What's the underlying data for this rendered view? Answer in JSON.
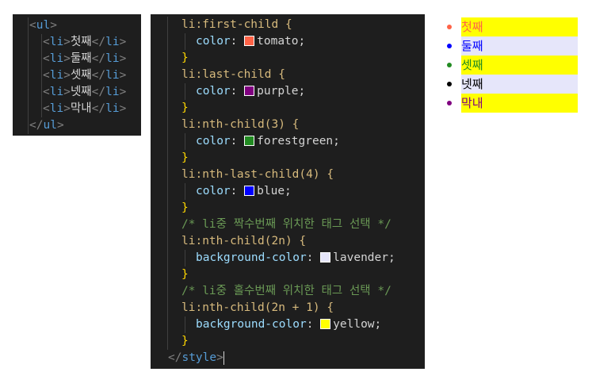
{
  "html_editor": {
    "lines": [
      {
        "indent": 0,
        "open_tag": "ul",
        "text": "",
        "close_tag": ""
      },
      {
        "indent": 1,
        "open_tag": "li",
        "text": "첫째",
        "close_tag": "li"
      },
      {
        "indent": 1,
        "open_tag": "li",
        "text": "둘째",
        "close_tag": "li"
      },
      {
        "indent": 1,
        "open_tag": "li",
        "text": "셋째",
        "close_tag": "li"
      },
      {
        "indent": 1,
        "open_tag": "li",
        "text": "넷째",
        "close_tag": "li"
      },
      {
        "indent": 1,
        "open_tag": "li",
        "text": "막내",
        "close_tag": "li"
      },
      {
        "indent": 0,
        "open_tag": "",
        "text": "",
        "close_tag": "ul"
      }
    ]
  },
  "css_editor": {
    "lines": [
      {
        "kind": "selector",
        "text": "li:first-child {"
      },
      {
        "kind": "decl",
        "prop": "color",
        "swatch": "#ff6347",
        "value": "tomato"
      },
      {
        "kind": "close",
        "text": "}"
      },
      {
        "kind": "selector",
        "text": "li:last-child {"
      },
      {
        "kind": "decl",
        "prop": "color",
        "swatch": "#800080",
        "value": "purple"
      },
      {
        "kind": "close",
        "text": "}"
      },
      {
        "kind": "selector",
        "text": "li:nth-child(3) {"
      },
      {
        "kind": "decl",
        "prop": "color",
        "swatch": "#228b22",
        "value": "forestgreen"
      },
      {
        "kind": "close",
        "text": "}"
      },
      {
        "kind": "selector",
        "text": "li:nth-last-child(4) {"
      },
      {
        "kind": "decl",
        "prop": "color",
        "swatch": "#0000ff",
        "value": "blue"
      },
      {
        "kind": "close",
        "text": "}"
      },
      {
        "kind": "comment",
        "text": "/* li중 짝수번째 위치한 태그 선택 */"
      },
      {
        "kind": "selector",
        "text": "li:nth-child(2n) {"
      },
      {
        "kind": "decl",
        "prop": "background-color",
        "swatch": "#e6e6fa",
        "value": "lavender"
      },
      {
        "kind": "close",
        "text": "}"
      },
      {
        "kind": "comment",
        "text": "/* li중 홀수번째 위치한 태그 선택 */"
      },
      {
        "kind": "selector",
        "text": "li:nth-child(2n + 1) {"
      },
      {
        "kind": "decl",
        "prop": "background-color",
        "swatch": "#ffff00",
        "value": "yellow"
      },
      {
        "kind": "close",
        "text": "}"
      },
      {
        "kind": "endtag",
        "tag": "style"
      }
    ]
  },
  "rendered_list": {
    "items": [
      {
        "label": "첫째",
        "color": "#ff6347",
        "background": "#ffff00"
      },
      {
        "label": "둘째",
        "color": "#0000ff",
        "background": "#e6e6fa"
      },
      {
        "label": "셋째",
        "color": "#228b22",
        "background": "#ffff00"
      },
      {
        "label": "넷째",
        "color": "#000000",
        "background": "#e6e6fa"
      },
      {
        "label": "막내",
        "color": "#800080",
        "background": "#ffff00"
      }
    ]
  }
}
